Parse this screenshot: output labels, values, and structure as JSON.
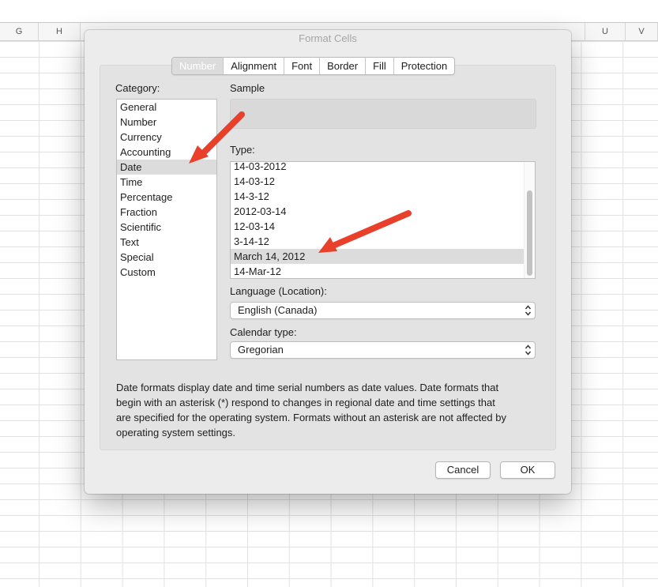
{
  "sheet": {
    "columns": [
      "G",
      "H",
      "U",
      "V"
    ]
  },
  "dialog": {
    "title": "Format Cells",
    "tabs": [
      "Number",
      "Alignment",
      "Font",
      "Border",
      "Fill",
      "Protection"
    ],
    "active_tab": "Number",
    "category": {
      "label": "Category:",
      "items": [
        "General",
        "Number",
        "Currency",
        "Accounting",
        "Date",
        "Time",
        "Percentage",
        "Fraction",
        "Scientific",
        "Text",
        "Special",
        "Custom"
      ],
      "selected": "Date"
    },
    "sample": {
      "label": "Sample",
      "value": ""
    },
    "type": {
      "label": "Type:",
      "items": [
        "14-03-2012",
        "14-03-12",
        "14-3-12",
        "2012-03-14",
        "12-03-14",
        "3-14-12",
        "March 14, 2012",
        "14-Mar-12"
      ],
      "selected": "March 14, 2012"
    },
    "language": {
      "label": "Language (Location):",
      "value": "English (Canada)"
    },
    "calendar": {
      "label": "Calendar type:",
      "value": "Gregorian"
    },
    "description": "Date formats display date and time serial numbers as date values.  Date formats that begin with an asterisk (*) respond to changes in regional date and time settings that are specified for the operating system. Formats without an asterisk are not affected by operating system settings.",
    "buttons": {
      "cancel": "Cancel",
      "ok": "OK"
    }
  },
  "colors": {
    "annotation_arrow": "#e8402a",
    "selection": "#dcdcdc",
    "dialog_background": "#ececec"
  }
}
